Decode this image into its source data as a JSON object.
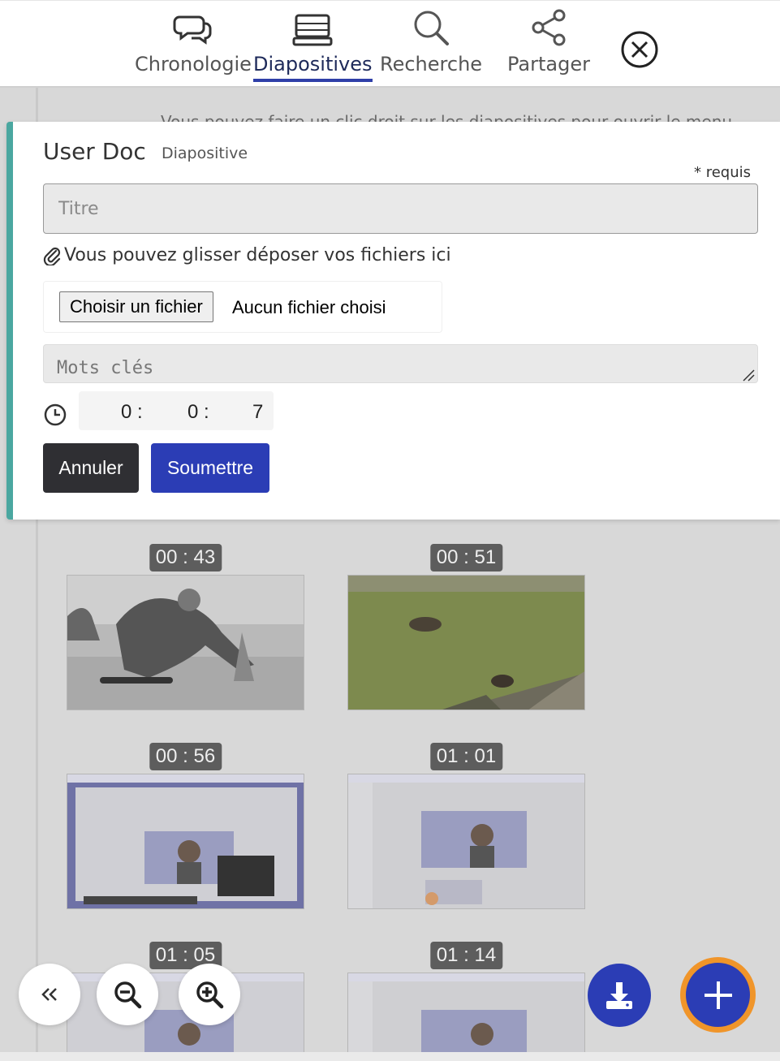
{
  "nav": {
    "tabs": [
      {
        "label": "Chronologie",
        "icon": "comments-icon",
        "active": false
      },
      {
        "label": "Diapositives",
        "icon": "laptop-icon",
        "active": true
      },
      {
        "label": "Recherche",
        "icon": "search-icon",
        "active": false
      },
      {
        "label": "Partager",
        "icon": "share-icon",
        "active": false
      }
    ],
    "close_icon": "close-circle-icon"
  },
  "hint_text": "Vous pouvez faire un clic droit sur les diapositives pour ouvrir le menu",
  "form": {
    "title": "User Doc",
    "subtitle": "Diapositive",
    "required_note": "* requis",
    "title_placeholder": "Titre",
    "drop_hint": "Vous pouvez glisser déposer vos fichiers ici",
    "file_button": "Choisir un fichier",
    "file_status": "Aucun fichier choisi",
    "keywords_placeholder": "Mots clés",
    "time": {
      "hours": "0",
      "minutes": "0",
      "seconds": "7",
      "sep1": ":",
      "sep2": ":"
    },
    "cancel_label": "Annuler",
    "submit_label": "Soumettre"
  },
  "slides": [
    {
      "timestamp": "00 : 43",
      "kind": "skateboard photo"
    },
    {
      "timestamp": "00 : 51",
      "kind": "pond photo"
    },
    {
      "timestamp": "00 : 56",
      "kind": "screenshot"
    },
    {
      "timestamp": "01 : 01",
      "kind": "screenshot"
    },
    {
      "timestamp": "01 : 05",
      "kind": "screenshot"
    },
    {
      "timestamp": "01 : 14",
      "kind": "screenshot"
    }
  ],
  "fabs": {
    "collapse": "double-chevron-left-icon",
    "zoom_out": "zoom-out-icon",
    "zoom_in": "zoom-in-icon",
    "download": "download-icon",
    "add": "plus-icon"
  },
  "colors": {
    "accent_blue": "#2b3db5",
    "panel_border": "#4aa7a0",
    "fab_ring": "#f0952a",
    "cancel_dark": "#2f2f33"
  }
}
